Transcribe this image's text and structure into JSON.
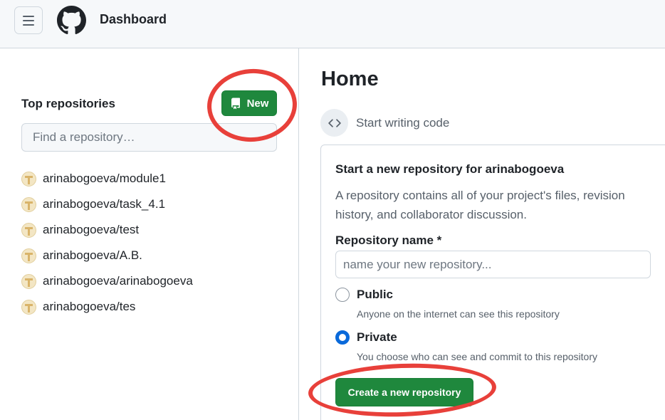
{
  "header": {
    "title": "Dashboard",
    "menu_icon": "hamburger-menu-icon",
    "logo_icon": "github-logo-icon"
  },
  "sidebar": {
    "top_repositories_title": "Top repositories",
    "new_button_label": "New",
    "find_placeholder": "Find a repository…",
    "repositories": [
      "arinabogoeva/module1",
      "arinabogoeva/task_4.1",
      "arinabogoeva/test",
      "arinabogoeva/A.B.",
      "arinabogoeva/arinabogoeva",
      "arinabogoeva/tes"
    ]
  },
  "main": {
    "home_title": "Home",
    "start_writing_label": "Start writing code",
    "new_repo_card": {
      "title": "Start a new repository for arinabogoeva",
      "description": "A repository contains all of your project's files, revision history, and collaborator discussion.",
      "repo_name_label": "Repository name *",
      "repo_name_placeholder": "name your new repository...",
      "visibility_options": [
        {
          "label": "Public",
          "description": "Anyone on the internet can see this repository",
          "checked": false
        },
        {
          "label": "Private",
          "description": "You choose who can see and commit to this repository",
          "checked": true
        }
      ],
      "create_button_label": "Create a new repository"
    }
  },
  "colors": {
    "primary_green": "#1f883d",
    "annotation_red": "#e8403a",
    "radio_blue": "#0969da"
  }
}
